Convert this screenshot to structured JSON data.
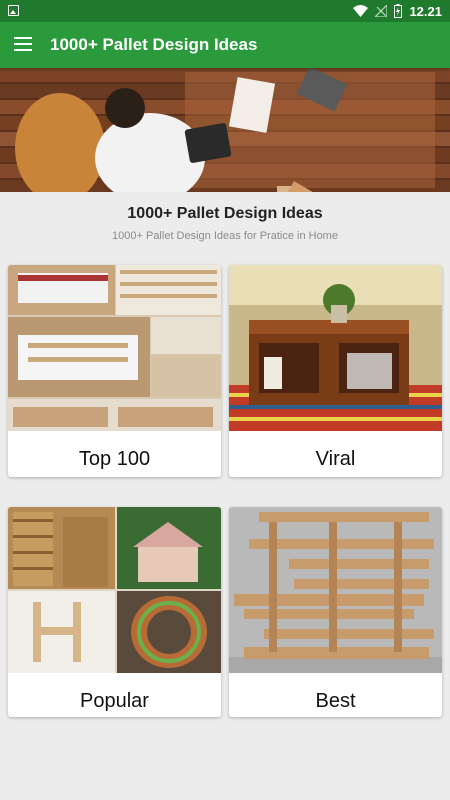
{
  "status_bar": {
    "time": "12.21"
  },
  "app_bar": {
    "title": "1000+ Pallet Design Ideas"
  },
  "header": {
    "heading": "1000+ Pallet Design Ideas",
    "subheading": "1000+ Pallet Design Ideas for Pratice in Home"
  },
  "categories": [
    {
      "label": "Top 100"
    },
    {
      "label": "Viral"
    },
    {
      "label": "Popular"
    },
    {
      "label": "Best"
    }
  ],
  "colors": {
    "status_bar": "#1f7a2e",
    "app_bar": "#2a9a3c",
    "background": "#ececec"
  },
  "icons": [
    "image-icon",
    "wifi-icon",
    "no-signal-icon",
    "battery-icon",
    "menu-icon"
  ]
}
